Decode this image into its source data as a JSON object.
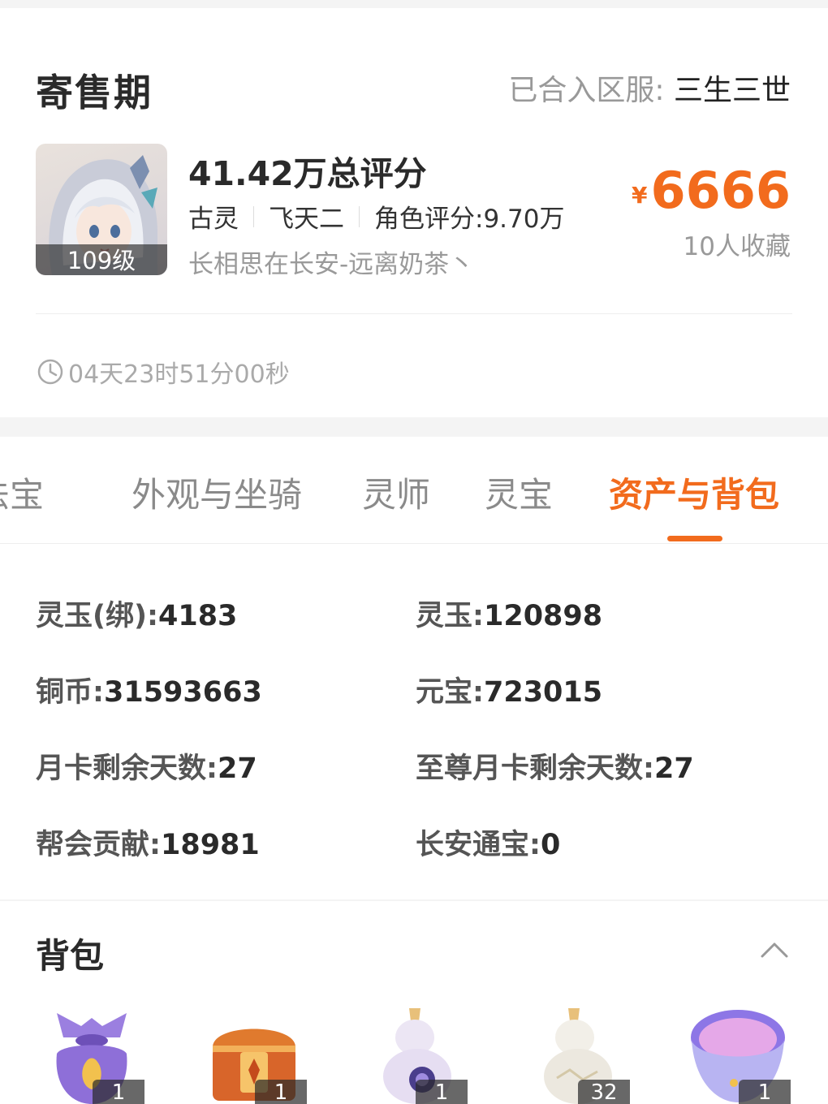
{
  "header": {
    "status_title": "寄售期",
    "server_label": "已合入区服:",
    "server_name": "三生三世"
  },
  "role": {
    "level_badge": "109级",
    "total_score": "41.42万总评分",
    "school": "古灵",
    "tier": "飞天二",
    "role_score": "角色评分:9.70万",
    "name": "长相思在长安-远离奶茶丶",
    "currency_symbol": "¥",
    "price": "6666",
    "favorites": "10人收藏",
    "countdown": "04天23时51分00秒"
  },
  "tabs": [
    {
      "label": "法宝"
    },
    {
      "label": "外观与坐骑"
    },
    {
      "label": "灵师"
    },
    {
      "label": "灵宝"
    },
    {
      "label": "资产与背包",
      "active": true
    }
  ],
  "assets": [
    {
      "label": "灵玉(绑):",
      "value": "4183"
    },
    {
      "label": "灵玉:",
      "value": "120898"
    },
    {
      "label": "铜币:",
      "value": "31593663"
    },
    {
      "label": "元宝:",
      "value": "723015"
    },
    {
      "label": "月卡剩余天数:",
      "value": "27"
    },
    {
      "label": "至尊月卡剩余天数:",
      "value": "27"
    },
    {
      "label": "帮会贡献:",
      "value": "18981"
    },
    {
      "label": "长安通宝:",
      "value": "0"
    }
  ],
  "bag": {
    "title": "背包",
    "items": [
      {
        "icon": "purple-pouch-icon",
        "count": "1"
      },
      {
        "icon": "treasure-chest-icon",
        "count": "1"
      },
      {
        "icon": "purple-gourd-icon",
        "count": "1"
      },
      {
        "icon": "white-gourd-icon",
        "count": "32"
      },
      {
        "icon": "purple-bowl-icon",
        "count": "1"
      }
    ]
  },
  "colors": {
    "accent": "#f26b1d",
    "text_primary": "#2a2a2a",
    "text_muted": "#999999",
    "background": "#f4f4f4"
  }
}
